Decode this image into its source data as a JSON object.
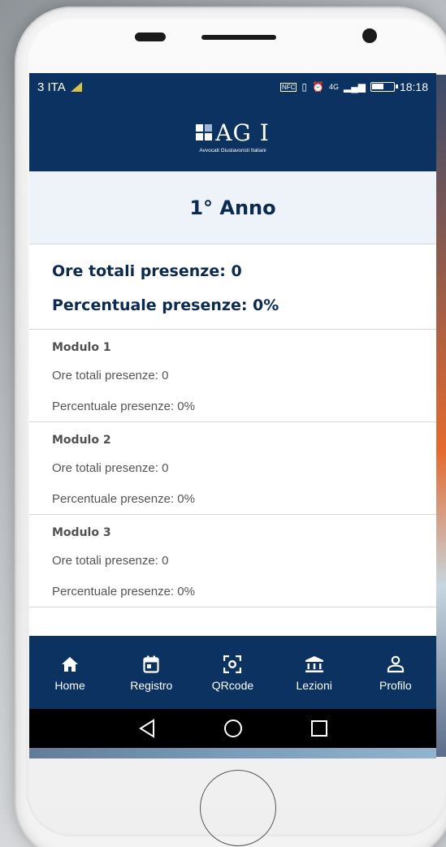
{
  "status_bar": {
    "carrier": "3 ITA",
    "network": "4G",
    "time": "18:18",
    "icons": [
      "nfc-icon",
      "vibrate-icon",
      "alarm-icon",
      "signal-icon",
      "battery-icon"
    ]
  },
  "header": {
    "logo_text": "AG I",
    "logo_subtitle": "Avvocati Giuslavoristi Italiani"
  },
  "year": {
    "title": "1° Anno"
  },
  "totals": {
    "hours_line": "Ore totali presenze: 0",
    "percent_line": "Percentuale presenze: 0%"
  },
  "modules": [
    {
      "title": "Modulo 1",
      "hours": "Ore totali presenze: 0",
      "percent": "Percentuale presenze: 0%"
    },
    {
      "title": "Modulo 2",
      "hours": "Ore totali presenze: 0",
      "percent": "Percentuale presenze: 0%"
    },
    {
      "title": "Modulo 3",
      "hours": "Ore totali presenze: 0",
      "percent": "Percentuale presenze: 0%"
    }
  ],
  "nav": [
    {
      "label": "Home",
      "icon": "home-icon"
    },
    {
      "label": "Registro",
      "icon": "calendar-icon"
    },
    {
      "label": "QRcode",
      "icon": "qrcode-scan-icon"
    },
    {
      "label": "Lezioni",
      "icon": "bank-icon"
    },
    {
      "label": "Profilo",
      "icon": "user-icon"
    }
  ],
  "colors": {
    "primary": "#0b3260",
    "heading": "#0b2a52",
    "year_bg": "#eef3f9"
  }
}
